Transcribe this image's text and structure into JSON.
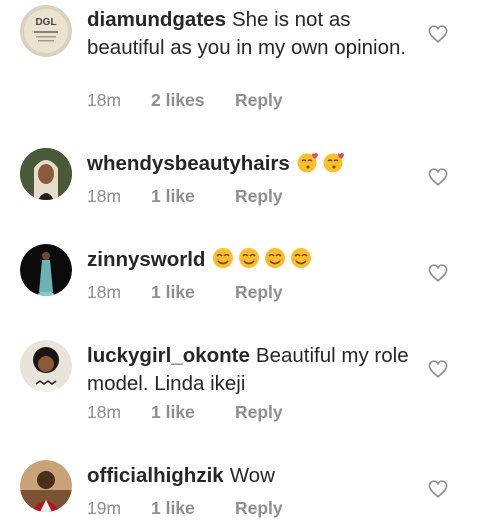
{
  "comments": [
    {
      "username": "diamundgates",
      "text": "She is not as beautiful as you in my own opinion.",
      "time": "18m",
      "likes": "2 likes",
      "reply": "Reply",
      "avatar_text": "DGL",
      "emoji_count": 0
    },
    {
      "username": "whendysbeautyhairs",
      "text": "",
      "time": "18m",
      "likes": "1 like",
      "reply": "Reply",
      "emoji_count": 2,
      "emoji_icon": "kissing-face-icon"
    },
    {
      "username": "zinnysworld",
      "text": "",
      "time": "18m",
      "likes": "1 like",
      "reply": "Reply",
      "emoji_count": 4,
      "emoji_icon": "smiling-face-icon"
    },
    {
      "username": "luckygirl_okonte",
      "text": "Beautiful my role model. Linda ikeji",
      "time": "18m",
      "likes": "1 like",
      "reply": "Reply",
      "emoji_count": 0
    },
    {
      "username": "officialhighzik",
      "text": "Wow",
      "time": "19m",
      "likes": "1 like",
      "reply": "Reply",
      "emoji_count": 0
    }
  ],
  "colors": {
    "text": "#262626",
    "meta": "#8e8e8e",
    "heart": "#8e8e8e",
    "emoji": "#f7c02c"
  },
  "icons": {
    "like": "heart-outline-icon"
  }
}
